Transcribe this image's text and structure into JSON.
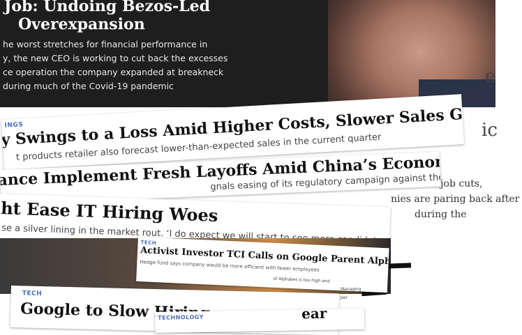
{
  "clippings": {
    "top": {
      "title_line1": "Job: Undoing Bezos-Led",
      "title_line2": "Overexpansion",
      "dek_line1": "he worst stretches for financial performance in",
      "dek_line2": "y, the new CEO is working to cut back the excesses",
      "dek_line3": "ce operation the company expanded at breakneck",
      "dek_line4": "during much of the Covid-19 pandemic"
    },
    "side": {
      "big1": "e",
      "big2": "ic",
      "line1": "ls of job cuts,",
      "line2": "nies are paring back after",
      "line3": "during the"
    },
    "loss": {
      "tag": "INGS",
      "headline": "y Swings to a Loss Amid Higher Costs, Slower Sales Growth",
      "dek": "t products retailer also forecast lower-than-expected sales in the current quarter"
    },
    "china": {
      "headline": "ance Implement Fresh Layoffs Amid China’s Economic Pains",
      "dek": "gnals easing of its regulatory campaign against the sector"
    },
    "hiring": {
      "headline": "ht Ease IT Hiring Woes",
      "dek": "se a silver lining in the market rout. ‘I do expect we will start to see more candidates,’ says one CIO"
    },
    "tci": {
      "tag": "TECH",
      "headline": "Activist Investor TCI Calls on Google Parent Alphabet to Slash Costs",
      "dek": "Hedge fund says company would be more efficient with fewer employees",
      "fragment1": "of Alphabet is too high and",
      "fragment2": "Managing",
      "fragment3": "per"
    },
    "google": {
      "tag": "TECH",
      "headline": "Google to Slow Hiring"
    },
    "bottom": {
      "tag": "TECHNOLOGY",
      "headline_fragment": "ear"
    }
  }
}
